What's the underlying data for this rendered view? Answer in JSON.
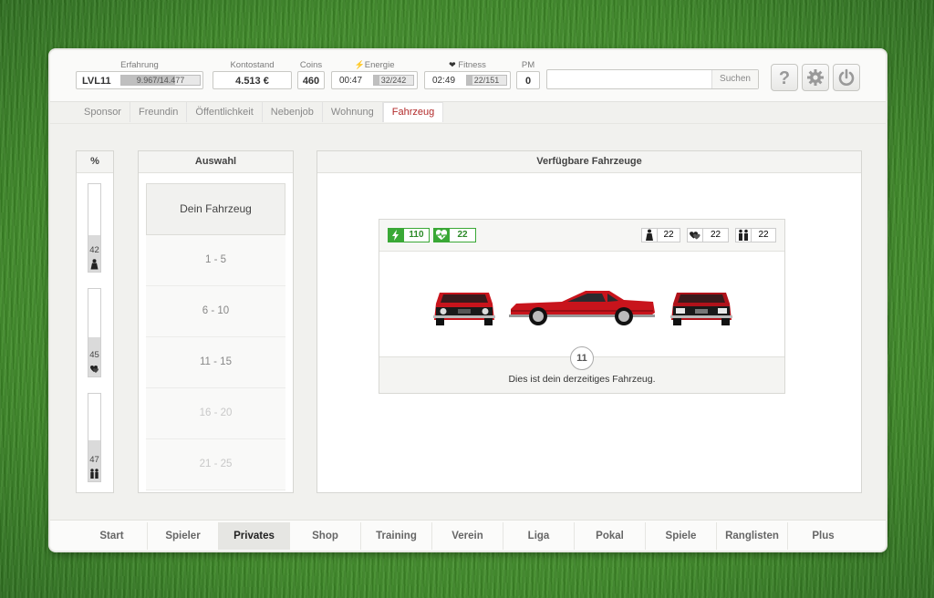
{
  "stats": {
    "level": "LVL11",
    "experience": {
      "label": "Erfahrung",
      "text": "9.967/14.477",
      "fraction": 0.69
    },
    "balance": {
      "label": "Kontostand",
      "value": "4.513 €"
    },
    "coins": {
      "label": "Coins",
      "value": "460"
    },
    "energy": {
      "label": "Energie",
      "timer": "00:47",
      "text": "32/242",
      "fraction": 0.13
    },
    "fitness": {
      "label": "Fitness",
      "timer": "02:49",
      "text": "22/151",
      "fraction": 0.15
    },
    "pm": {
      "label": "PM",
      "value": "0"
    }
  },
  "search": {
    "placeholder": "",
    "button": "Suchen"
  },
  "icons": {
    "help": "help-icon",
    "settings": "gear-icon",
    "logout": "power-icon"
  },
  "subnav": [
    "Sponsor",
    "Freundin",
    "Öffentlichkeit",
    "Nebenjob",
    "Wohnung",
    "Fahrzeug"
  ],
  "subnav_active": "Fahrzeug",
  "percent_panel": {
    "title": "%",
    "meters": [
      {
        "value": "42",
        "icon": "person-icon",
        "fraction": 0.42
      },
      {
        "value": "45",
        "icon": "hearts-icon",
        "fraction": 0.45
      },
      {
        "value": "47",
        "icon": "couple-icon",
        "fraction": 0.47
      }
    ]
  },
  "selection": {
    "title": "Auswahl",
    "items": [
      "Dein Fahrzeug",
      "1 - 5",
      "6 - 10",
      "11 - 15",
      "16 - 20",
      "21 - 25"
    ]
  },
  "vehicles": {
    "title": "Verfügbare Fahrzeuge",
    "energy": "110",
    "fitness": "22",
    "person": "22",
    "hearts": "22",
    "couple": "22",
    "level": "11",
    "caption": "Dies ist dein derzeitiges Fahrzeug."
  },
  "colors": {
    "accent": "#b22a2a",
    "green": "#3aa836",
    "car": "#c8141c"
  },
  "bottomnav": [
    "Start",
    "Spieler",
    "Privates",
    "Shop",
    "Training",
    "Verein",
    "Liga",
    "Pokal",
    "Spiele",
    "Ranglisten",
    "Plus"
  ],
  "bottomnav_active": "Privates"
}
